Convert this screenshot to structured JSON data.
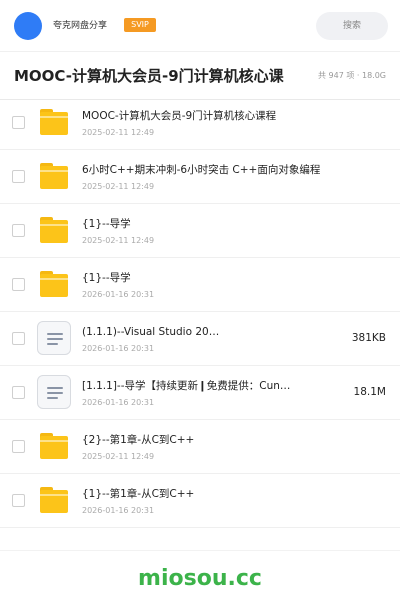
{
  "header": {
    "user_name": "夸克网盘分享",
    "badge": "SVIP",
    "search_placeholder": "搜索"
  },
  "share": {
    "title": "MOOC-计算机大会员-9门计算机核心课",
    "meta": "共 947 项 · 18.0G"
  },
  "files": [
    {
      "type": "folder",
      "name": "MOOC-计算机大会员-9门计算机核心课程",
      "date": "2025-02-11 12:49",
      "size": ""
    },
    {
      "type": "folder",
      "name": "6小时C++期末冲刺-6小时突击 C++面向对象编程",
      "date": "2025-02-11 12:49",
      "size": ""
    },
    {
      "type": "folder",
      "name": "{1}--导学",
      "date": "2025-02-11 12:49",
      "size": ""
    },
    {
      "type": "folder",
      "name": "{1}--导学",
      "date": "2026-01-16 20:31",
      "size": ""
    },
    {
      "type": "document",
      "name": "(1.1.1)--Visual Studio 20…",
      "date": "2026-01-16 20:31",
      "size": "381KB"
    },
    {
      "type": "document",
      "name": "[1.1.1]--导学【持续更新❙免费提供：Cun…",
      "date": "2026-01-16 20:31",
      "size": "18.1M"
    },
    {
      "type": "folder",
      "name": "{2}--第1章-从C到C++",
      "date": "2025-02-11 12:49",
      "size": ""
    },
    {
      "type": "folder",
      "name": "{1}--第1章-从C到C++",
      "date": "2026-01-16 20:31",
      "size": ""
    }
  ],
  "colors": {
    "accent_blue": "#2f7cf6",
    "svip_orange": "#f59a23",
    "folder_yellow": "#fcc419",
    "watermark_green": "#3cb34a"
  },
  "watermark": "miosou.cc"
}
